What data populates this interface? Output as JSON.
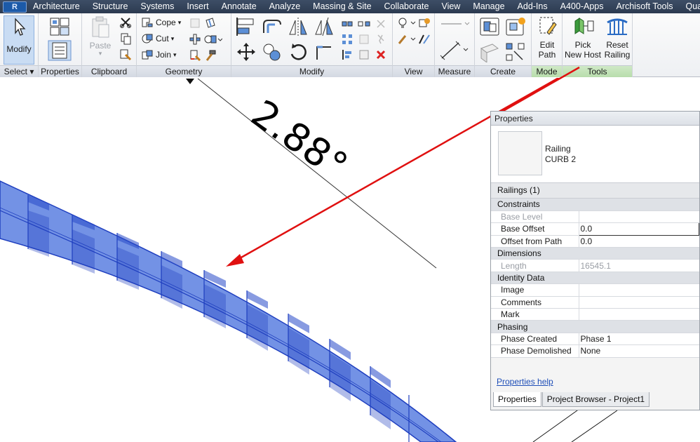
{
  "menu_tabs": [
    "Architecture",
    "Structure",
    "Systems",
    "Insert",
    "Annotate",
    "Analyze",
    "Massing & Site",
    "Collaborate",
    "View",
    "Manage",
    "Add-Ins",
    "A400-Apps",
    "Archisoft Tools",
    "Quantifica"
  ],
  "ribbon": {
    "select_panel": {
      "title": "Select",
      "modify_label": "Modify"
    },
    "properties_panel": {
      "title": "Properties"
    },
    "clipboard_panel": {
      "title": "Clipboard",
      "paste_label": "Paste"
    },
    "geometry_panel": {
      "title": "Geometry",
      "cope_label": "Cope",
      "cut_label": "Cut",
      "join_label": "Join"
    },
    "modify_panel": {
      "title": "Modify"
    },
    "view_panel": {
      "title": "View"
    },
    "measure_panel": {
      "title": "Measure"
    },
    "create_panel": {
      "title": "Create"
    },
    "mode_panel": {
      "title": "Mode",
      "edit_path_label_1": "Edit",
      "edit_path_label_2": "Path"
    },
    "tools_panel": {
      "title": "Tools",
      "pick_host_label_1": "Pick",
      "pick_host_label_2": "New Host",
      "reset_label_1": "Reset",
      "reset_label_2": "Railing"
    }
  },
  "canvas": {
    "angle_annotation": "2.88°"
  },
  "properties": {
    "title": "Properties",
    "family": "Railing",
    "type": "CURB 2",
    "instance_selector": "Railings (1)",
    "groups": [
      {
        "name": "Constraints",
        "rows": [
          {
            "key": "Base Level",
            "value": "",
            "dim": true
          },
          {
            "key": "Base Offset",
            "value": "0.0",
            "editing": true
          },
          {
            "key": "Offset from Path",
            "value": "0.0"
          }
        ]
      },
      {
        "name": "Dimensions",
        "rows": [
          {
            "key": "Length",
            "value": "16545.1",
            "dim": true
          }
        ]
      },
      {
        "name": "Identity Data",
        "rows": [
          {
            "key": "Image",
            "value": ""
          },
          {
            "key": "Comments",
            "value": ""
          },
          {
            "key": "Mark",
            "value": ""
          }
        ]
      },
      {
        "name": "Phasing",
        "rows": [
          {
            "key": "Phase Created",
            "value": "Phase 1"
          },
          {
            "key": "Phase Demolished",
            "value": "None"
          }
        ]
      }
    ],
    "help_link": "Properties help",
    "tabs": [
      "Properties",
      "Project Browser - Project1"
    ]
  },
  "colors": {
    "railing_fill": "#5b7fe0",
    "railing_edge": "#1f3fbf",
    "arrow": "#e01010",
    "ribbon_green": "#cfe9c6"
  }
}
